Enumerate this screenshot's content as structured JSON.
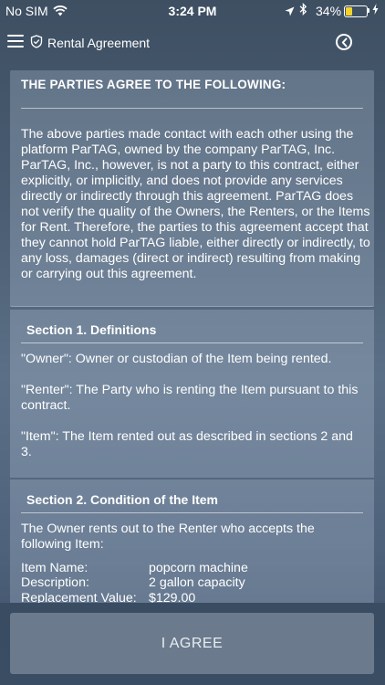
{
  "status_bar": {
    "carrier": "No SIM",
    "time": "3:24 PM",
    "battery_pct": "34%",
    "battery_level": 0.34,
    "battery_color": "#f5d32a"
  },
  "nav": {
    "title": "Rental Agreement",
    "menu_icon": "hamburger-menu",
    "title_icon": "shield-check",
    "back_icon": "back-circle"
  },
  "intro": {
    "heading": "THE PARTIES AGREE TO THE FOLLOWING:",
    "body": "The above parties made contact with each other using the platform ParTAG, owned by the company ParTAG, Inc. ParTAG, Inc., however, is not a party to this contract, either explicitly, or implicitly, and does not provide any services directly or indirectly through this agreement. ParTAG does not verify the quality of the Owners, the Renters, or the Items for Rent. Therefore, the parties to this agreement accept that they cannot hold ParTAG liable, either directly or indirectly, to any loss, damages (direct or indirect) resulting from making or carrying out this agreement."
  },
  "section1": {
    "title": "Section 1. Definitions",
    "definitions": [
      "\"Owner\": Owner or custodian of the Item being rented.",
      "\"Renter\": The Party who is renting the Item pursuant to this contract.",
      "\"Item\": The Item rented out as described in sections 2 and 3."
    ]
  },
  "section2": {
    "title": "Section 2. Condition of the Item",
    "intro": "The Owner rents out to the Renter who accepts the following Item:",
    "items": [
      {
        "label": "Item Name:",
        "value": "popcorn machine"
      },
      {
        "label": "Description:",
        "value": "2 gallon capacity"
      },
      {
        "label": "Replacement Value:",
        "value": "$129.00"
      }
    ]
  },
  "agree_button": "I AGREE"
}
